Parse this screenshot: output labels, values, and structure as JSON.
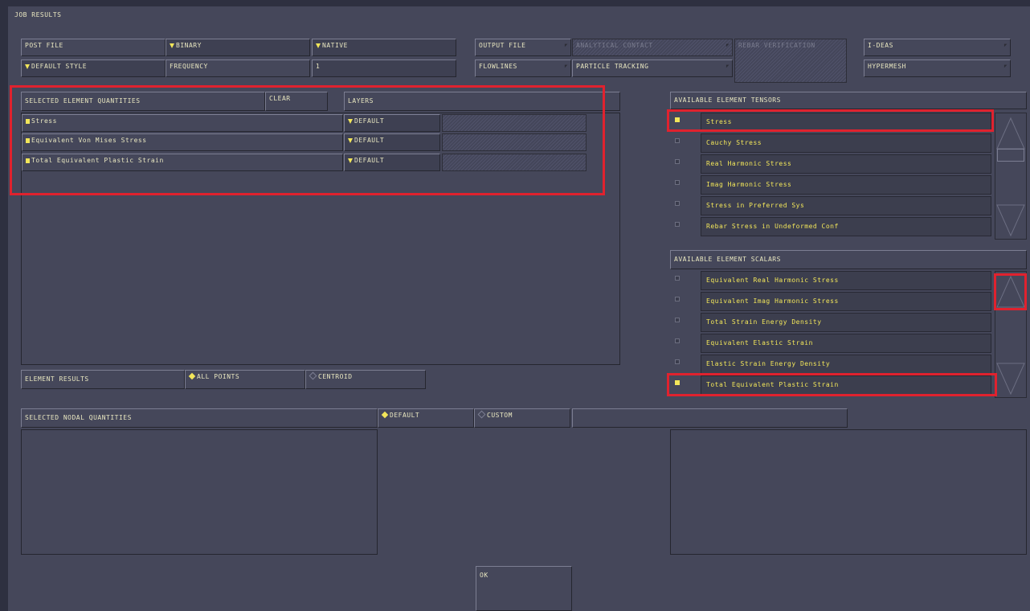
{
  "window": {
    "title": "JOB RESULTS"
  },
  "topbar": {
    "post_file": "POST FILE",
    "binary": "BINARY",
    "native": "NATIVE",
    "default_style": "DEFAULT STYLE",
    "frequency": "FREQUENCY",
    "frequency_value": "1",
    "output_file": "OUTPUT FILE",
    "analytical_contact": "ANALYTICAL CONTACT",
    "rebar_verification": "REBAR VERIFICATION",
    "ideas": "I-DEAS",
    "flowlines": "FLOWLINES",
    "particle_tracking": "PARTICLE TRACKING",
    "hypermesh": "HYPERMESH"
  },
  "selected_element": {
    "header": "SELECTED ELEMENT QUANTITIES",
    "clear": "CLEAR",
    "layers": "LAYERS",
    "rows": [
      {
        "label": "Stress",
        "layer": "DEFAULT"
      },
      {
        "label": "Equivalent Von Mises Stress",
        "layer": "DEFAULT"
      },
      {
        "label": "Total Equivalent Plastic Strain",
        "layer": "DEFAULT"
      }
    ]
  },
  "element_results": {
    "label": "ELEMENT RESULTS",
    "all_points": "ALL POINTS",
    "centroid": "CENTROID"
  },
  "tensors": {
    "header": "AVAILABLE ELEMENT TENSORS",
    "items": [
      {
        "label": "Stress",
        "checked": true
      },
      {
        "label": "Cauchy Stress",
        "checked": false
      },
      {
        "label": "Real Harmonic Stress",
        "checked": false
      },
      {
        "label": "Imag Harmonic Stress",
        "checked": false
      },
      {
        "label": "Stress in Preferred Sys",
        "checked": false
      },
      {
        "label": "Rebar Stress in Undeformed Conf",
        "checked": false
      }
    ]
  },
  "scalars": {
    "header": "AVAILABLE ELEMENT SCALARS",
    "items": [
      {
        "label": "Equivalent Real Harmonic Stress",
        "checked": false
      },
      {
        "label": "Equivalent Imag Harmonic Stress",
        "checked": false
      },
      {
        "label": "Total Strain Energy Density",
        "checked": false
      },
      {
        "label": "Equivalent Elastic Strain",
        "checked": false
      },
      {
        "label": "Elastic Strain Energy Density",
        "checked": false
      },
      {
        "label": "Total Equivalent Plastic Strain",
        "checked": true
      }
    ]
  },
  "nodal": {
    "header": "SELECTED NODAL QUANTITIES",
    "default": "DEFAULT",
    "custom": "CUSTOM"
  },
  "ok": "OK",
  "colors": {
    "background": "#45475a",
    "text": "#e8e6c0",
    "accent": "#f2e65a",
    "highlight": "#e0222e"
  }
}
